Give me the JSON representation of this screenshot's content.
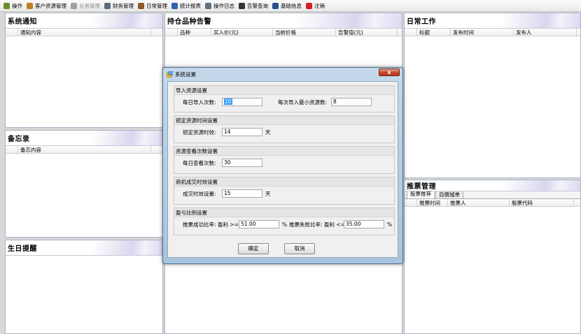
{
  "toolbar": {
    "items": [
      {
        "label": "操作",
        "icon": "tools-icon",
        "color": "#6b8e23",
        "enabled": true
      },
      {
        "label": "客户资源管理",
        "icon": "users-icon",
        "color": "#c08020",
        "enabled": true
      },
      {
        "label": "业务管理",
        "icon": "gear-icon",
        "color": "#a0a0a0",
        "enabled": false
      },
      {
        "label": "财务管理",
        "icon": "printer-icon",
        "color": "#5a6a7a",
        "enabled": true
      },
      {
        "label": "日常管理",
        "icon": "notebook-icon",
        "color": "#8b5a2b",
        "enabled": true
      },
      {
        "label": "统计报表",
        "icon": "bar-chart-icon",
        "color": "#2f5fb0",
        "enabled": true
      },
      {
        "label": "操作日志",
        "icon": "log-icon",
        "color": "#607080",
        "enabled": true
      },
      {
        "label": "告警查询",
        "icon": "binoculars-icon",
        "color": "#333333",
        "enabled": true
      },
      {
        "label": "基础信息",
        "icon": "person-icon",
        "color": "#2a4f8f",
        "enabled": true
      },
      {
        "label": "注销",
        "icon": "logout-icon",
        "color": "#d42020",
        "enabled": true
      }
    ]
  },
  "panels": {
    "notice": {
      "title": "系统通知",
      "columns": [
        "通知内容"
      ]
    },
    "memo": {
      "title": "备忘录",
      "columns": [
        "备忘内容"
      ]
    },
    "birthday": {
      "title": "生日提醒"
    },
    "holding": {
      "title": "持仓品种告警",
      "columns": [
        "品种",
        "买入价(元)",
        "当前价格",
        "告警值(元)"
      ]
    },
    "daily": {
      "title": "日常工作",
      "columns": [
        "标题",
        "发布时间",
        "发布人"
      ]
    },
    "recommend": {
      "title": "推票管理",
      "tabs": [
        "股票推荐",
        "自撰城单"
      ],
      "columns": [
        "推票时间",
        "推票人",
        "股票代码"
      ]
    }
  },
  "dialog": {
    "title": "系统设置",
    "close_label": "x",
    "groups": {
      "import": {
        "title": "导入资源设置",
        "daily_label": "每日导入次数:",
        "daily_value": "20",
        "min_label": "每次导入最小资源数:",
        "min_value": "8"
      },
      "lock": {
        "title": "锁定资源时间设置",
        "label": "锁定资源时效:",
        "value": "14",
        "unit": "天"
      },
      "view": {
        "title": "资源查看次数设置",
        "label": "每日查看次数:",
        "value": "30"
      },
      "deal": {
        "title": "商机成交时效设置",
        "label": "成交时效设置:",
        "value": "15",
        "unit": "天"
      },
      "ratio": {
        "title": "盈亏比例设置",
        "success_label": "推票成功比率: 盈利 >=",
        "success_value": "51.00",
        "success_unit": "%",
        "fail_label": "推票失败比率: 盈利 <=",
        "fail_value": "35.00",
        "fail_unit": "%"
      }
    },
    "ok_label": "确定",
    "cancel_label": "取消"
  }
}
